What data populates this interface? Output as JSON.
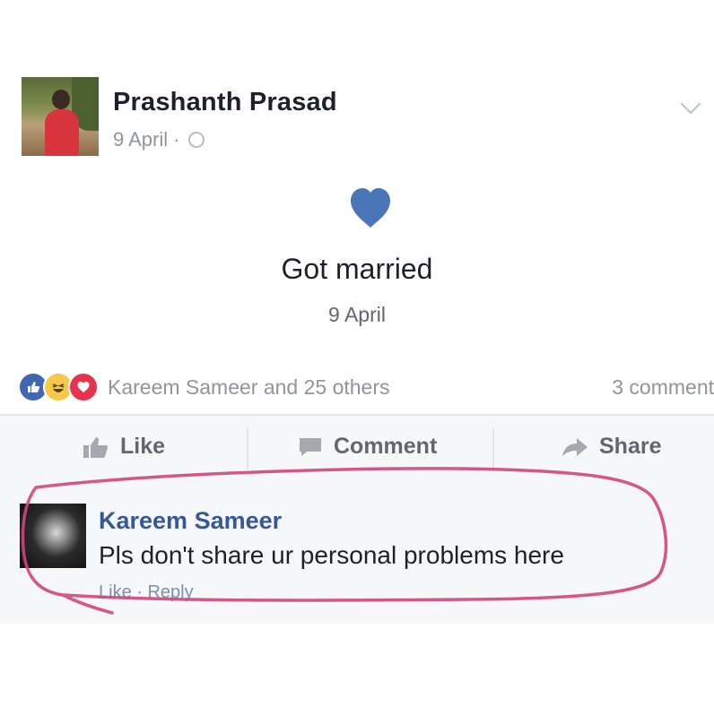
{
  "post": {
    "author": "Prashanth Prasad",
    "date": "9 April",
    "meta_separator": "·",
    "privacy_icon": "globe-icon",
    "menu_icon": "chevron-down-icon"
  },
  "life_event": {
    "icon": "heart-icon",
    "title": "Got married",
    "date": "9 April"
  },
  "reactions": {
    "icons": [
      "like-icon",
      "haha-icon",
      "love-icon"
    ],
    "summary": "Kareem Sameer and 25 others",
    "comments_count": "3 comment"
  },
  "actions": {
    "like_label": "Like",
    "comment_label": "Comment",
    "share_label": "Share"
  },
  "comment": {
    "author": "Kareem Sameer",
    "text": "Pls don't share ur personal problems here",
    "actions": "Like · Reply"
  },
  "colors": {
    "brand_blue": "#4267b2",
    "link_blue": "#365899",
    "annotation_pink": "#d1457a",
    "muted_text": "#90949c"
  }
}
